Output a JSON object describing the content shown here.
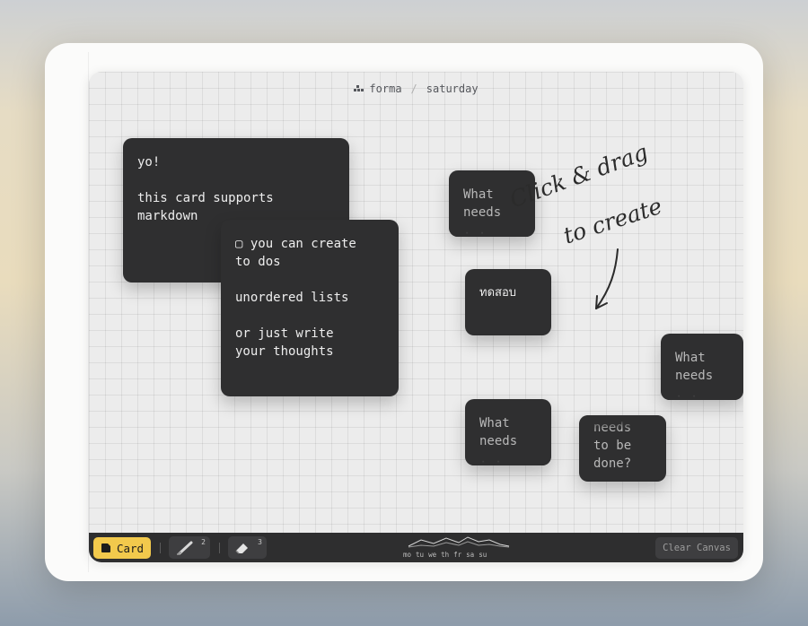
{
  "breadcrumb": {
    "app": "forma",
    "separator": "/",
    "page": "saturday"
  },
  "cards": {
    "intro": "yo!\n\nthis card supports\nmarkdown",
    "features": "▢ you can create\nto dos\n\nunordered lists\n\nor just write\nyour thoughts",
    "small_top": "What\nneeds\n. .",
    "thai": "ทดสอบ",
    "small_right": "What\nneeds\n. .",
    "small_bottom": "What\nneeds\n. .",
    "small_done": "needs\nto be\ndone?"
  },
  "hint": {
    "line1": "Click & drag",
    "line2": "to create"
  },
  "toolbar": {
    "card_label": "Card",
    "pen_badge": "2",
    "eraser_badge": "3",
    "days": [
      "mo",
      "tu",
      "we",
      "th",
      "fr",
      "sa",
      "su"
    ],
    "clear_label": "Clear Canvas",
    "accent_color": "#f2c94c"
  },
  "icons": {
    "logo": "forma-logo-icon",
    "card": "card-icon",
    "pen": "pen-icon",
    "eraser": "eraser-icon",
    "arrow": "arrow-down-icon"
  }
}
